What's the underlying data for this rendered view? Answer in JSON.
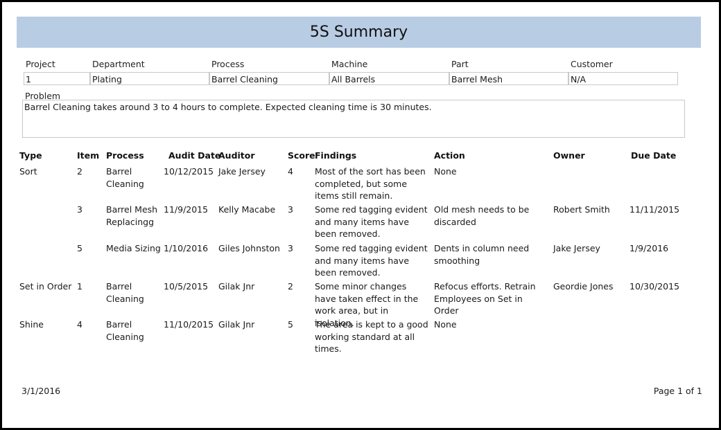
{
  "title": "5S Summary",
  "header_fields": {
    "labels": [
      "Project",
      "Department",
      "Process",
      "Machine",
      "Part",
      "Customer"
    ],
    "values": [
      "1",
      "Plating",
      "Barrel Cleaning",
      "All Barrels",
      "Barrel Mesh",
      "N/A"
    ]
  },
  "problem": {
    "label": "Problem",
    "text": "Barrel Cleaning takes around 3 to 4 hours to complete. Expected cleaning time is 30 minutes."
  },
  "table": {
    "columns": [
      "Type",
      "Item",
      "Process",
      "Audit Date",
      "Auditor",
      "Score",
      "Findings",
      "Action",
      "Owner",
      "Due Date"
    ],
    "rows": [
      {
        "type": "Sort",
        "item": "2",
        "process": "Barrel Cleaning",
        "audit_date": "10/12/2015",
        "auditor": "Jake Jersey",
        "score": "4",
        "findings": "Most of the sort has been completed, but some items still remain.",
        "action": "None",
        "owner": "",
        "due_date": ""
      },
      {
        "type": "",
        "item": "3",
        "process": "Barrel Mesh Replacingg",
        "audit_date": "11/9/2015",
        "auditor": "Kelly Macabe",
        "score": "3",
        "findings": "Some red tagging evident and many items have been removed.",
        "action": "Old mesh needs to be discarded",
        "owner": "Robert Smith",
        "due_date": "11/11/2015"
      },
      {
        "type": "",
        "item": "5",
        "process": "Media Sizing",
        "audit_date": "1/10/2016",
        "auditor": "Giles Johnston",
        "score": "3",
        "findings": "Some red tagging evident and many items have been removed.",
        "action": "Dents in column need smoothing",
        "owner": "Jake Jersey",
        "due_date": "1/9/2016"
      },
      {
        "type": "Set in Order",
        "item": "1",
        "process": "Barrel Cleaning",
        "audit_date": "10/5/2015",
        "auditor": "Gilak Jnr",
        "score": "2",
        "findings": "Some minor changes have taken effect in the work area, but in isolation.",
        "action": "Refocus efforts. Retrain Employees on Set in Order",
        "owner": "Geordie Jones",
        "due_date": "10/30/2015"
      },
      {
        "type": "Shine",
        "item": "4",
        "process": "Barrel Cleaning",
        "audit_date": "11/10/2015",
        "auditor": "Gilak Jnr",
        "score": "5",
        "findings": "The area is kept to a good working standard at all times.",
        "action": "None",
        "owner": "",
        "due_date": ""
      }
    ]
  },
  "footer": {
    "date": "3/1/2016",
    "page": "Page 1 of 1"
  },
  "colors": {
    "title_band": "#b8cce4",
    "border": "#000000"
  }
}
